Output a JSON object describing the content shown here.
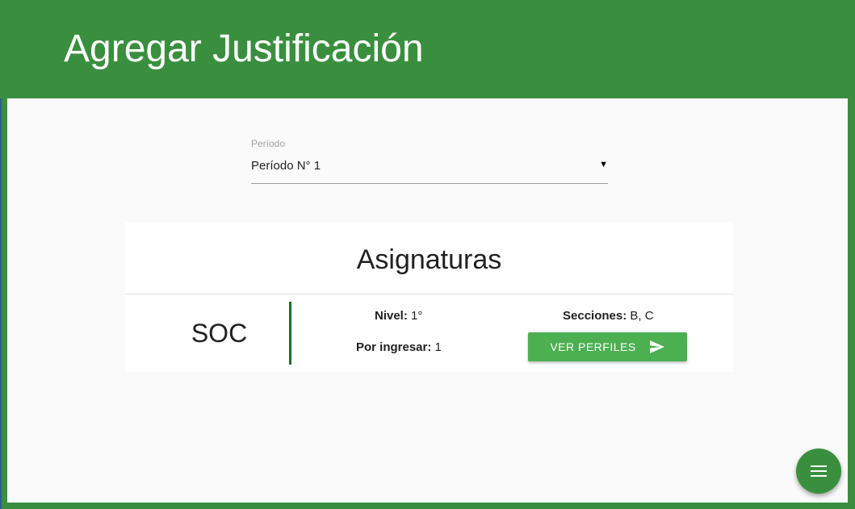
{
  "header": {
    "title": "Agregar Justificación"
  },
  "period_select": {
    "label": "Período",
    "value": "Período N° 1",
    "arrow_icon": "dropdown-arrow-icon"
  },
  "card": {
    "title": "Asignaturas",
    "subject": {
      "code": "SOC",
      "nivel_label": "Nivel:",
      "nivel_value": "1°",
      "por_ingresar_label": "Por ingresar:",
      "por_ingresar_value": "1",
      "secciones_label": "Secciones:",
      "secciones_value": "B, C",
      "button_label": "VER PERFILES",
      "button_icon": "send-icon"
    }
  },
  "fab": {
    "icon": "menu-icon"
  },
  "colors": {
    "primary": "#3a8f3f",
    "button": "#4caf50",
    "accent_bar": "#1b6e24",
    "background": "#fafafa"
  }
}
